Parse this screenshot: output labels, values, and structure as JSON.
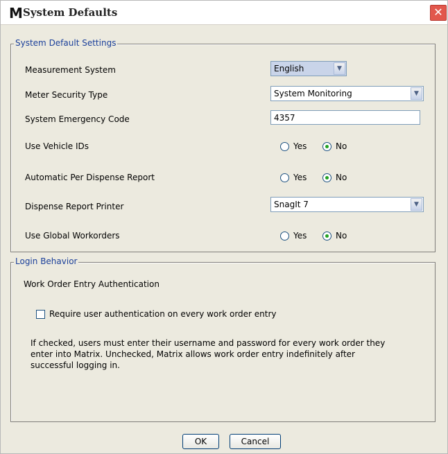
{
  "window": {
    "icon": "M",
    "title": "System Defaults",
    "close_label": "✕"
  },
  "system_defaults": {
    "legend": "System Default Settings",
    "measurement_system": {
      "label": "Measurement System",
      "value": "English",
      "arrow": "▼"
    },
    "meter_security_type": {
      "label": "Meter Security Type",
      "value": "System Monitoring",
      "arrow": "▼"
    },
    "system_emergency_code": {
      "label": "System Emergency Code",
      "value": "4357"
    },
    "use_vehicle_ids": {
      "label": "Use Vehicle IDs",
      "yes": "Yes",
      "no": "No",
      "selected": "No"
    },
    "automatic_per_dispense_report": {
      "label": "Automatic Per Dispense Report",
      "yes": "Yes",
      "no": "No",
      "selected": "No"
    },
    "dispense_report_printer": {
      "label": "Dispense Report Printer",
      "value": "SnagIt 7",
      "arrow": "▼"
    },
    "use_global_workorders": {
      "label": "Use Global Workorders",
      "yes": "Yes",
      "no": "No",
      "selected": "No"
    }
  },
  "login_behavior": {
    "legend": "Login Behavior",
    "heading": "Work Order Entry Authentication",
    "checkbox_label": "Require user authentication on every work order entry",
    "checkbox_checked": false,
    "description_line1": "If checked, users must enter their username and password for every work order they",
    "description_line2": "enter into Matrix.  Unchecked, Matrix allows work order entry indefinitely after",
    "description_line3": "successful logging in."
  },
  "buttons": {
    "ok": "OK",
    "cancel": "Cancel"
  }
}
